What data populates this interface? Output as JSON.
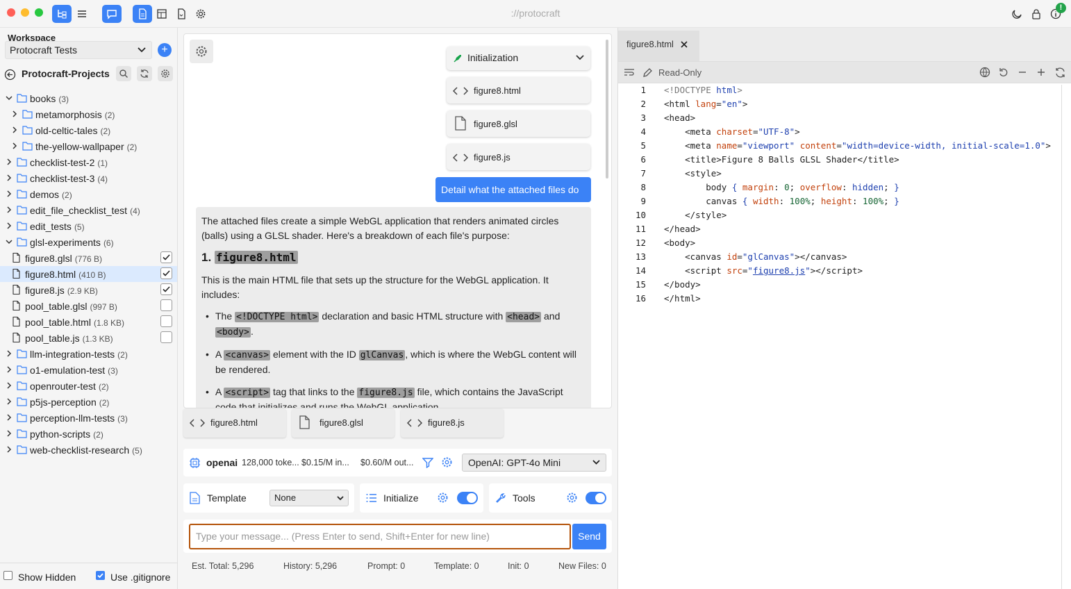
{
  "app": {
    "title": "://protocraft",
    "notification_badge": "!"
  },
  "sidebar": {
    "workspace_label": "Workspace",
    "workspace_value": "Protocraft Tests",
    "project_title": "Protocraft-Projects",
    "tree": [
      {
        "type": "folder",
        "name": "books",
        "count": "(3)",
        "expanded": true,
        "depth": 0
      },
      {
        "type": "folder",
        "name": "metamorphosis",
        "count": "(2)",
        "expanded": false,
        "depth": 1
      },
      {
        "type": "folder",
        "name": "old-celtic-tales",
        "count": "(2)",
        "expanded": false,
        "depth": 1
      },
      {
        "type": "folder",
        "name": "the-yellow-wallpaper",
        "count": "(2)",
        "expanded": false,
        "depth": 1
      },
      {
        "type": "folder",
        "name": "checklist-test-2",
        "count": "(1)",
        "expanded": false,
        "depth": 0
      },
      {
        "type": "folder",
        "name": "checklist-test-3",
        "count": "(4)",
        "expanded": false,
        "depth": 0
      },
      {
        "type": "folder",
        "name": "demos",
        "count": "(2)",
        "expanded": false,
        "depth": 0
      },
      {
        "type": "folder",
        "name": "edit_file_checklist_test",
        "count": "(4)",
        "expanded": false,
        "depth": 0
      },
      {
        "type": "folder",
        "name": "edit_tests",
        "count": "(5)",
        "expanded": false,
        "depth": 0
      },
      {
        "type": "folder",
        "name": "glsl-experiments",
        "count": "(6)",
        "expanded": true,
        "depth": 0
      },
      {
        "type": "file",
        "name": "figure8.glsl",
        "count": "(776 B)",
        "checked": true,
        "depth": 1
      },
      {
        "type": "file",
        "name": "figure8.html",
        "count": "(410 B)",
        "checked": true,
        "selected": true,
        "depth": 1
      },
      {
        "type": "file",
        "name": "figure8.js",
        "count": "(2.9 KB)",
        "checked": true,
        "depth": 1
      },
      {
        "type": "file",
        "name": "pool_table.glsl",
        "count": "(997 B)",
        "checked": false,
        "depth": 1
      },
      {
        "type": "file",
        "name": "pool_table.html",
        "count": "(1.8 KB)",
        "checked": false,
        "depth": 1
      },
      {
        "type": "file",
        "name": "pool_table.js",
        "count": "(1.3 KB)",
        "checked": false,
        "depth": 1
      },
      {
        "type": "folder",
        "name": "llm-integration-tests",
        "count": "(2)",
        "expanded": false,
        "depth": 0
      },
      {
        "type": "folder",
        "name": "o1-emulation-test",
        "count": "(3)",
        "expanded": false,
        "depth": 0
      },
      {
        "type": "folder",
        "name": "openrouter-test",
        "count": "(2)",
        "expanded": false,
        "depth": 0
      },
      {
        "type": "folder",
        "name": "p5js-perception",
        "count": "(2)",
        "expanded": false,
        "depth": 0
      },
      {
        "type": "folder",
        "name": "perception-llm-tests",
        "count": "(3)",
        "expanded": false,
        "depth": 0
      },
      {
        "type": "folder",
        "name": "python-scripts",
        "count": "(2)",
        "expanded": false,
        "depth": 0
      },
      {
        "type": "folder",
        "name": "web-checklist-research",
        "count": "(5)",
        "expanded": false,
        "depth": 0
      }
    ],
    "show_hidden_label": "Show Hidden",
    "show_hidden_checked": false,
    "use_gitignore_label": "Use .gitignore",
    "use_gitignore_checked": true
  },
  "chat": {
    "init_label": "Initialization",
    "attachments": [
      "figure8.html",
      "figure8.glsl",
      "figure8.js"
    ],
    "user_message": "Detail what the attached files do",
    "assistant": {
      "intro": "The attached files create a simple WebGL application that renders animated circles (balls) using a GLSL shader. Here's a breakdown of each file's purpose:",
      "h_num": "1.",
      "h_code": "figure8.html",
      "p1": "This is the main HTML file that sets up the structure for the WebGL application. It includes:",
      "b1_pre": "The",
      "b1_code1": "<!DOCTYPE html>",
      "b1_mid": "declaration and basic HTML structure with",
      "b1_code2": "<head>",
      "b1_and": "and",
      "b1_code3": "<body>",
      "b1_end": ".",
      "b2_pre": "A",
      "b2_code1": "<canvas>",
      "b2_mid": "element with the ID",
      "b2_code2": "glCanvas",
      "b2_end": ", which is where the WebGL content will be rendered.",
      "b3_pre": "A",
      "b3_code1": "<script>",
      "b3_mid": "tag that links to the",
      "b3_code2": "figure8.js",
      "b3_end": "file, which contains the JavaScript code that initializes and runs the WebGL application."
    },
    "file_tabs": [
      "figure8.html",
      "figure8.glsl",
      "figure8.js"
    ],
    "model": {
      "provider": "openai",
      "context": "128,000 toke...",
      "input_price": "$0.15/M in...",
      "output_price": "$0.60/M out...",
      "selected": "OpenAI: GPT-4o Mini"
    },
    "template": {
      "label": "Template",
      "value": "None"
    },
    "initialize": {
      "label": "Initialize",
      "enabled": true
    },
    "tools": {
      "label": "Tools",
      "enabled": true
    },
    "input_placeholder": "Type your message... (Press Enter to send, Shift+Enter for new line)",
    "send_label": "Send",
    "stats": {
      "est_total": "Est. Total: 5,296",
      "history": "History: 5,296",
      "prompt": "Prompt: 0",
      "template": "Template: 0",
      "init": "Init: 0",
      "new_files": "New Files: 0"
    }
  },
  "editor": {
    "tab_name": "figure8.html",
    "read_only_label": "Read-Only",
    "line_numbers": [
      "1",
      "2",
      "3",
      "4",
      "5",
      "6",
      "7",
      "8",
      "9",
      "10",
      "11",
      "12",
      "13",
      "14",
      "15",
      "16"
    ]
  },
  "colors": {
    "accent": "#3b82f6",
    "selected_row": "#dbeafe",
    "code_attr": "#c2410c",
    "code_value": "#166534"
  }
}
